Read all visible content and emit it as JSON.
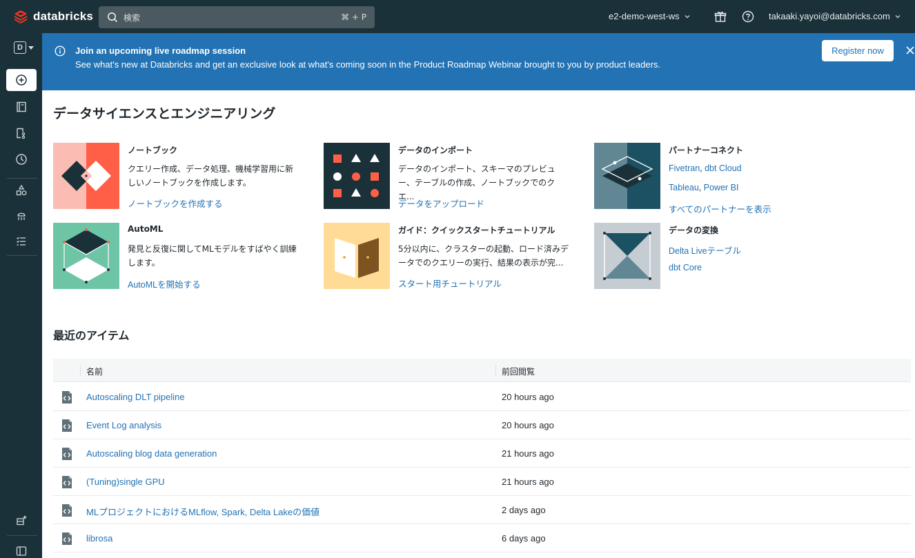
{
  "topbar": {
    "brand": "databricks",
    "search_placeholder": "検索",
    "search_shortcut": "⌘ + P",
    "workspace": "e2-demo-west-ws",
    "user": "takaaki.yayoi@databricks.com"
  },
  "sidebar": {
    "workspace_letter": "D",
    "items": [
      "new-icon",
      "workspace-icon",
      "repos-icon",
      "recents-icon",
      "data-icon",
      "compute-icon",
      "workflows-icon",
      "marketplace-icon",
      "collapse-icon"
    ]
  },
  "banner": {
    "title": "Join an upcoming live roadmap session",
    "description": "See what's new at Databricks and get an exclusive look at what's coming soon in the Product Roadmap Webinar brought to you by product leaders.",
    "button": "Register now"
  },
  "main": {
    "heading": "データサイエンスとエンジニアリング",
    "cards": [
      {
        "title": "ノートブック",
        "desc": "クエリー作成、データ処理、機械学習用に新しいノートブックを作成します。",
        "links": [
          "ノートブックを作成する"
        ]
      },
      {
        "title": "データのインポート",
        "desc": "データのインポート、スキーマのプレビュー、テーブルの作成、ノートブックでのクエ...",
        "links": [
          "データをアップロード"
        ]
      },
      {
        "title": "パートナーコネクト",
        "desc": "",
        "links": [
          "Fivetran",
          "dbt Cloud",
          "Tableau",
          "Power BI",
          "すべてのパートナーを表示"
        ]
      },
      {
        "title": "AutoML",
        "desc": "発見と反復に関してMLモデルをすばやく訓練します。",
        "links": [
          "AutoMLを開始する"
        ]
      },
      {
        "title": "ガイド：クイックスタートチュートリアル",
        "desc": "5分以内に、クラスターの起動、ロード済みデータでのクエリーの実行、結果の表示が完...",
        "links": [
          "スタート用チュートリアル"
        ]
      },
      {
        "title": "データの変換",
        "desc": "",
        "links": [
          "Delta Liveテーブル",
          "dbt Core"
        ]
      }
    ],
    "recent_heading": "最近のアイテム",
    "table": {
      "headers": [
        "名前",
        "前回閲覧"
      ],
      "rows": [
        {
          "name": "Autoscaling DLT pipeline",
          "time": "20 hours ago"
        },
        {
          "name": "Event Log analysis",
          "time": "20 hours ago"
        },
        {
          "name": "Autoscaling blog data generation",
          "time": "21 hours ago"
        },
        {
          "name": "(Tuning)single GPU",
          "time": "21 hours ago"
        },
        {
          "name": "MLプロジェクトにおけるMLflow, Spark, Delta Lakeの価値",
          "time": "2 days ago"
        },
        {
          "name": "librosa",
          "time": "6 days ago"
        }
      ]
    }
  },
  "colors": {
    "topbar": "#1b3139",
    "banner": "#2272b4",
    "link": "#2272b4",
    "brand_red": "#ff3621"
  }
}
